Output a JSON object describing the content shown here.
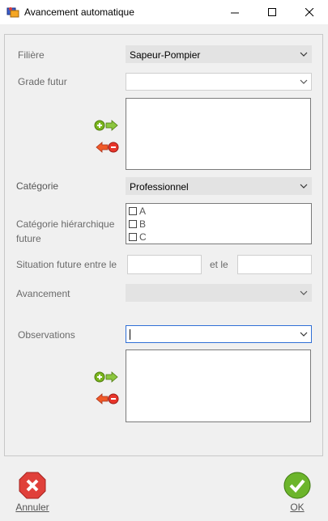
{
  "window": {
    "title": "Avancement automatique",
    "minimize": "—",
    "maximize": "☐",
    "close": "✕"
  },
  "form": {
    "filiere": {
      "label": "Filière",
      "value": "Sapeur-Pompier"
    },
    "grade_futur": {
      "label": "Grade futur",
      "value": ""
    },
    "categorie": {
      "label": "Catégorie",
      "value": "Professionnel"
    },
    "categorie_hierarchique": {
      "label_line1": "Catégorie hiérarchique",
      "label_line2": "future",
      "options": [
        "A",
        "B",
        "C"
      ]
    },
    "situation": {
      "label": "Situation future entre le",
      "between": "et le",
      "from": "",
      "to": ""
    },
    "avancement": {
      "label": "Avancement",
      "value": ""
    },
    "observations": {
      "label": "Observations",
      "value": ""
    }
  },
  "footer": {
    "cancel_label": "Annuler",
    "ok_label": "OK"
  },
  "colors": {
    "add": "#7ab51d",
    "remove": "#e8352b",
    "ok": "#6cb52b",
    "cancel": "#e0403a"
  }
}
